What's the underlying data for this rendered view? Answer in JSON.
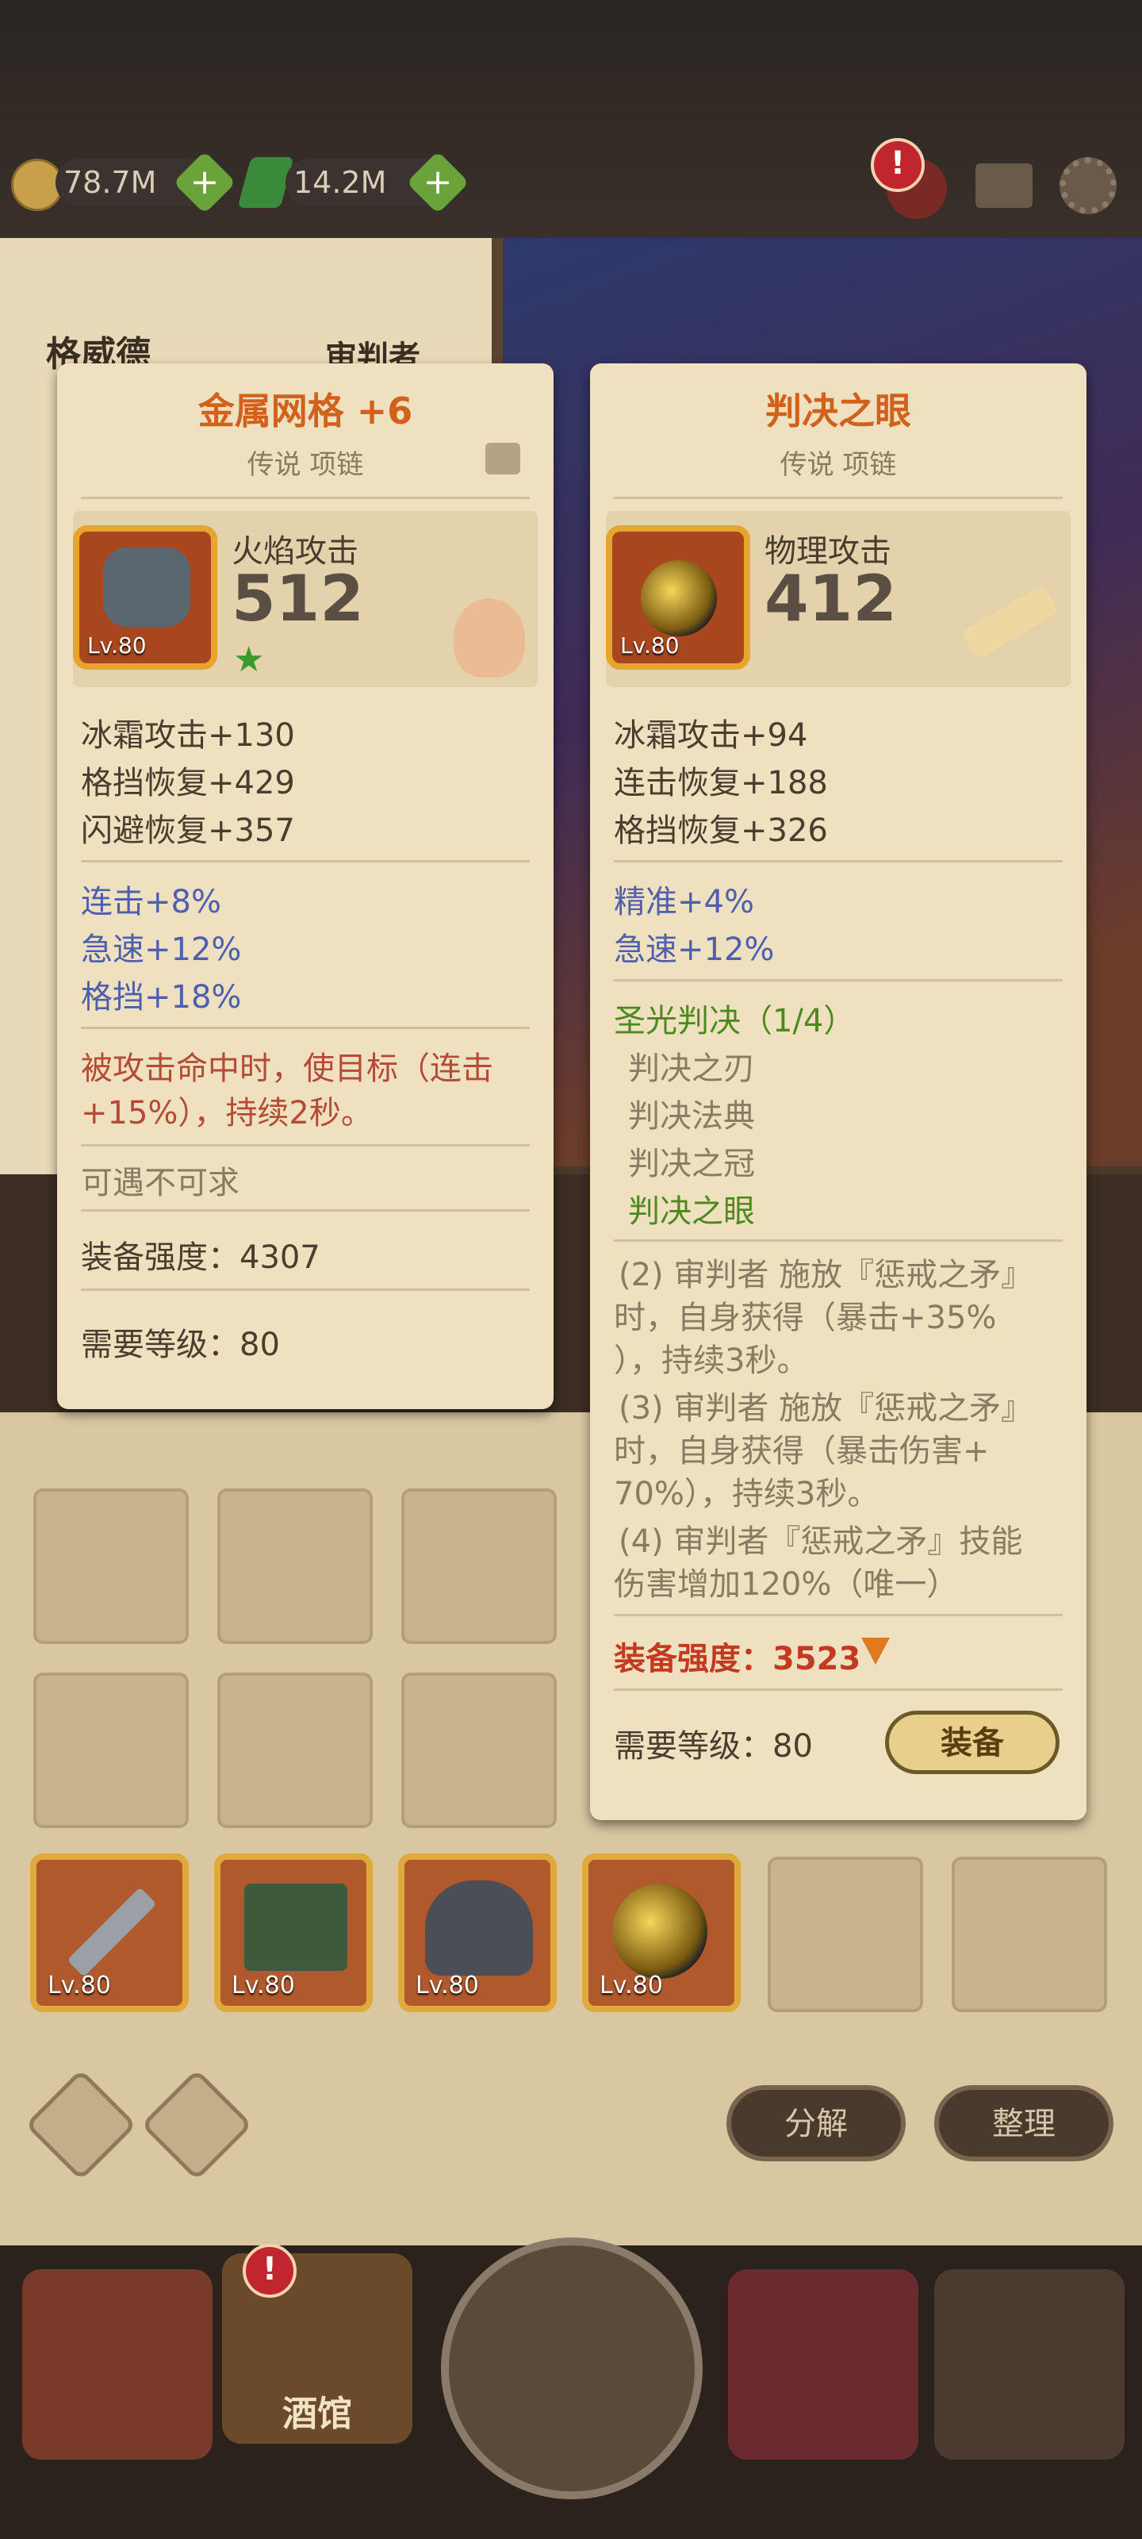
{
  "resources": {
    "gold": "78.7M",
    "gems": "14.2M"
  },
  "left_panel": {
    "hero_name": "格威德",
    "hero_class": "审判者"
  },
  "card_left": {
    "title": "金属网格 +6",
    "subtitle": "传说 项链",
    "main_label": "火焰攻击",
    "main_value": "512",
    "level": "Lv.80",
    "stats": [
      "冰霜攻击+130",
      "格挡恢复+429",
      "闪避恢复+357"
    ],
    "bonus_stats": [
      "连击+8%",
      "急速+12%",
      "格挡+18%"
    ],
    "effect": [
      "被攻击命中时，使目标（连击",
      "+15%），持续2秒。"
    ],
    "flavor": "可遇不可求",
    "strength": "装备强度：4307",
    "required_level": "需要等级：80"
  },
  "card_right": {
    "title": "判决之眼",
    "subtitle": "传说 项链",
    "main_label": "物理攻击",
    "main_value": "412",
    "level": "Lv.80",
    "stats": [
      "冰霜攻击+94",
      "连击恢复+188",
      "格挡恢复+326"
    ],
    "bonus_stats": [
      "精准+4%",
      "急速+12%"
    ],
    "set_name": "圣光判决（1/4）",
    "set_items": [
      "判决之刃",
      "判决法典",
      "判决之冠",
      "判决之眼"
    ],
    "set_bonuses": [
      [
        "(2) 审判者 施放『惩戒之矛』",
        "时，自身获得（暴击+35%",
        "），持续3秒。"
      ],
      [
        "(3) 审判者 施放『惩戒之矛』",
        "时，自身获得（暴击伤害+",
        "70%），持续3秒。"
      ],
      [
        "(4) 审判者『惩戒之矛』技能",
        "伤害增加120%（唯一）"
      ]
    ],
    "strength": "装备强度：3523",
    "required_level": "需要等级：80",
    "equip_button": "装备"
  },
  "equipped": [
    {
      "level": "Lv.80"
    },
    {
      "level": "Lv.80"
    },
    {
      "level": "Lv.80"
    },
    {
      "level": "Lv.80"
    }
  ],
  "buttons": {
    "decompose": "分解",
    "organize": "整理"
  },
  "nav": {
    "tavern": "酒馆"
  },
  "colors": {
    "title_orange": "#d2611b",
    "bonus_blue": "#4d5fae",
    "effect_red": "#b54a35",
    "set_green": "#4c8a1e",
    "strength_red": "#c43a20"
  },
  "icons": {
    "gold": "coin-icon",
    "gem": "gem-icon",
    "mail": "mail-icon",
    "settings": "gear-icon"
  }
}
